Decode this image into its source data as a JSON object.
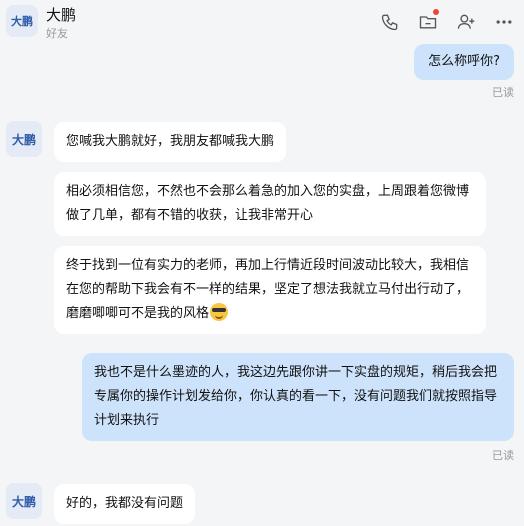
{
  "header": {
    "avatar_text": "大鹏",
    "name": "大鹏",
    "subtitle": "好友",
    "icons": [
      "phone-icon",
      "folder-icon",
      "add-user-icon",
      "more-icon"
    ]
  },
  "messages": [
    {
      "side": "out",
      "text": "怎么称呼你?",
      "status": "已读"
    },
    {
      "side": "in",
      "avatar": "大鹏",
      "text": "您喊我大鹏就好，我朋友都喊我大鹏"
    },
    {
      "side": "in",
      "text": "相必须相信您，不然也不会那么着急的加入您的实盘，上周跟着您微博做了几单，都有不错的收获，让我非常开心"
    },
    {
      "side": "in",
      "text": "终于找到一位有实力的老师，再加上行情近段时间波动比较大，我相信在您的帮助下我会有不一样的结果，坚定了想法我就立马付出行动了，磨磨唧唧可不是我的风格",
      "emoji": "sunglasses-emoji"
    },
    {
      "side": "out",
      "text": "我也不是什么墨迹的人，我这边先跟你讲一下实盘的规矩，稍后我会把专属你的操作计划发给你，你认真的看一下，没有问题我们就按照指导计划来执行",
      "status": "已读"
    },
    {
      "side": "in",
      "avatar": "大鹏",
      "text": "好的，我都没有问题"
    }
  ]
}
